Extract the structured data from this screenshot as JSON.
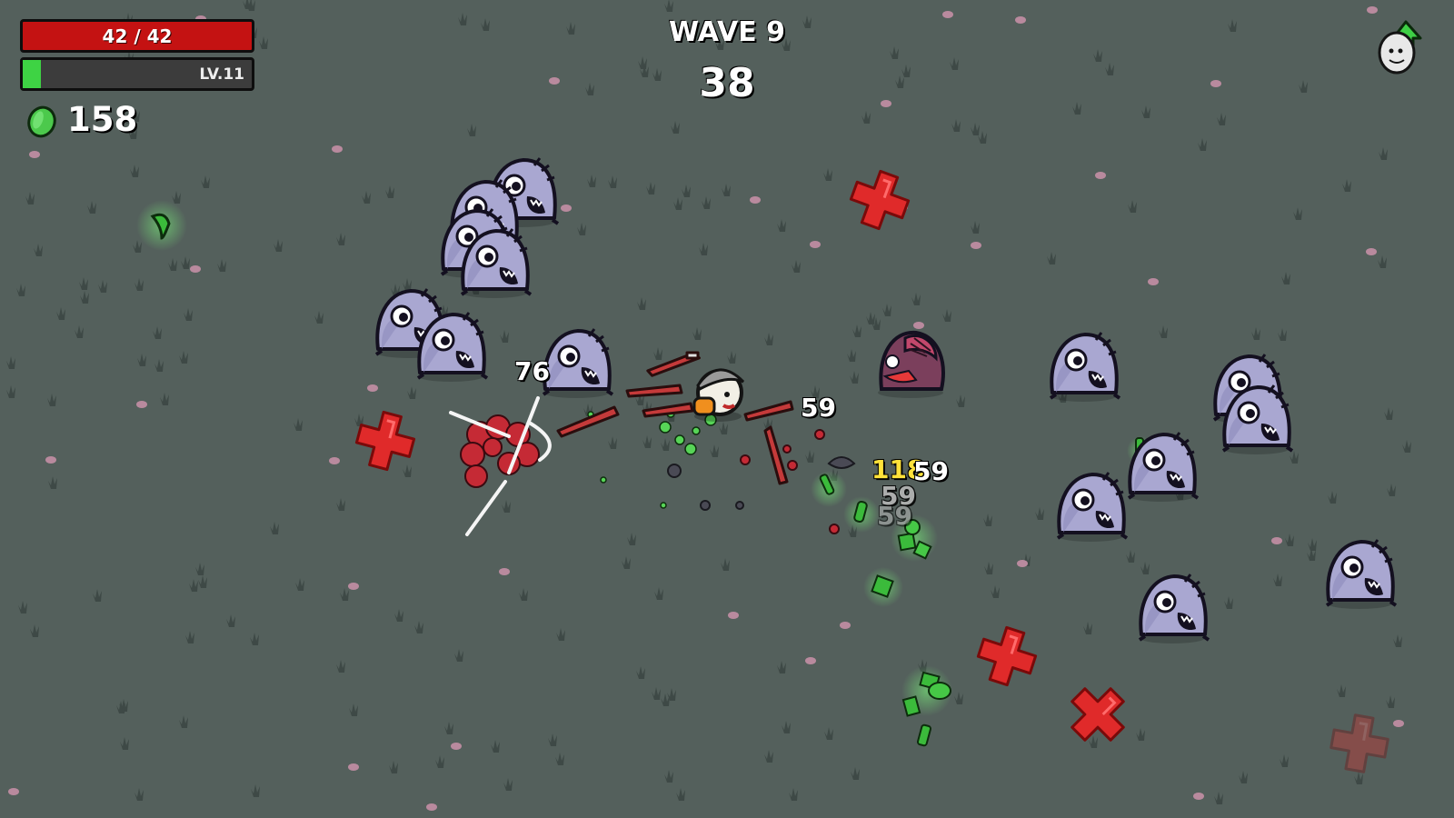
{
  "hud": {
    "health_text": "42 / 42",
    "health_fraction": 1.0,
    "level_text": "LV.11",
    "xp_fraction": 0.08,
    "materials_count": "158"
  },
  "wave": {
    "title": "WAVE 9",
    "timer": "38"
  },
  "damage_numbers": [
    "76",
    "59",
    "118",
    "59",
    "59",
    "59"
  ],
  "colors": {
    "background": "#54605c",
    "health": "#c41212",
    "xp": "#3ed344",
    "material": "#57d457",
    "enemy": "#a9a7d1",
    "enemy_dark": "#5b5680",
    "hit_marker": "#e22a2a"
  },
  "icons": {
    "materials": "green-material-icon",
    "level_up": "level-up-egg-icon",
    "spawn_marker": "red-cross-spawn-icon"
  }
}
